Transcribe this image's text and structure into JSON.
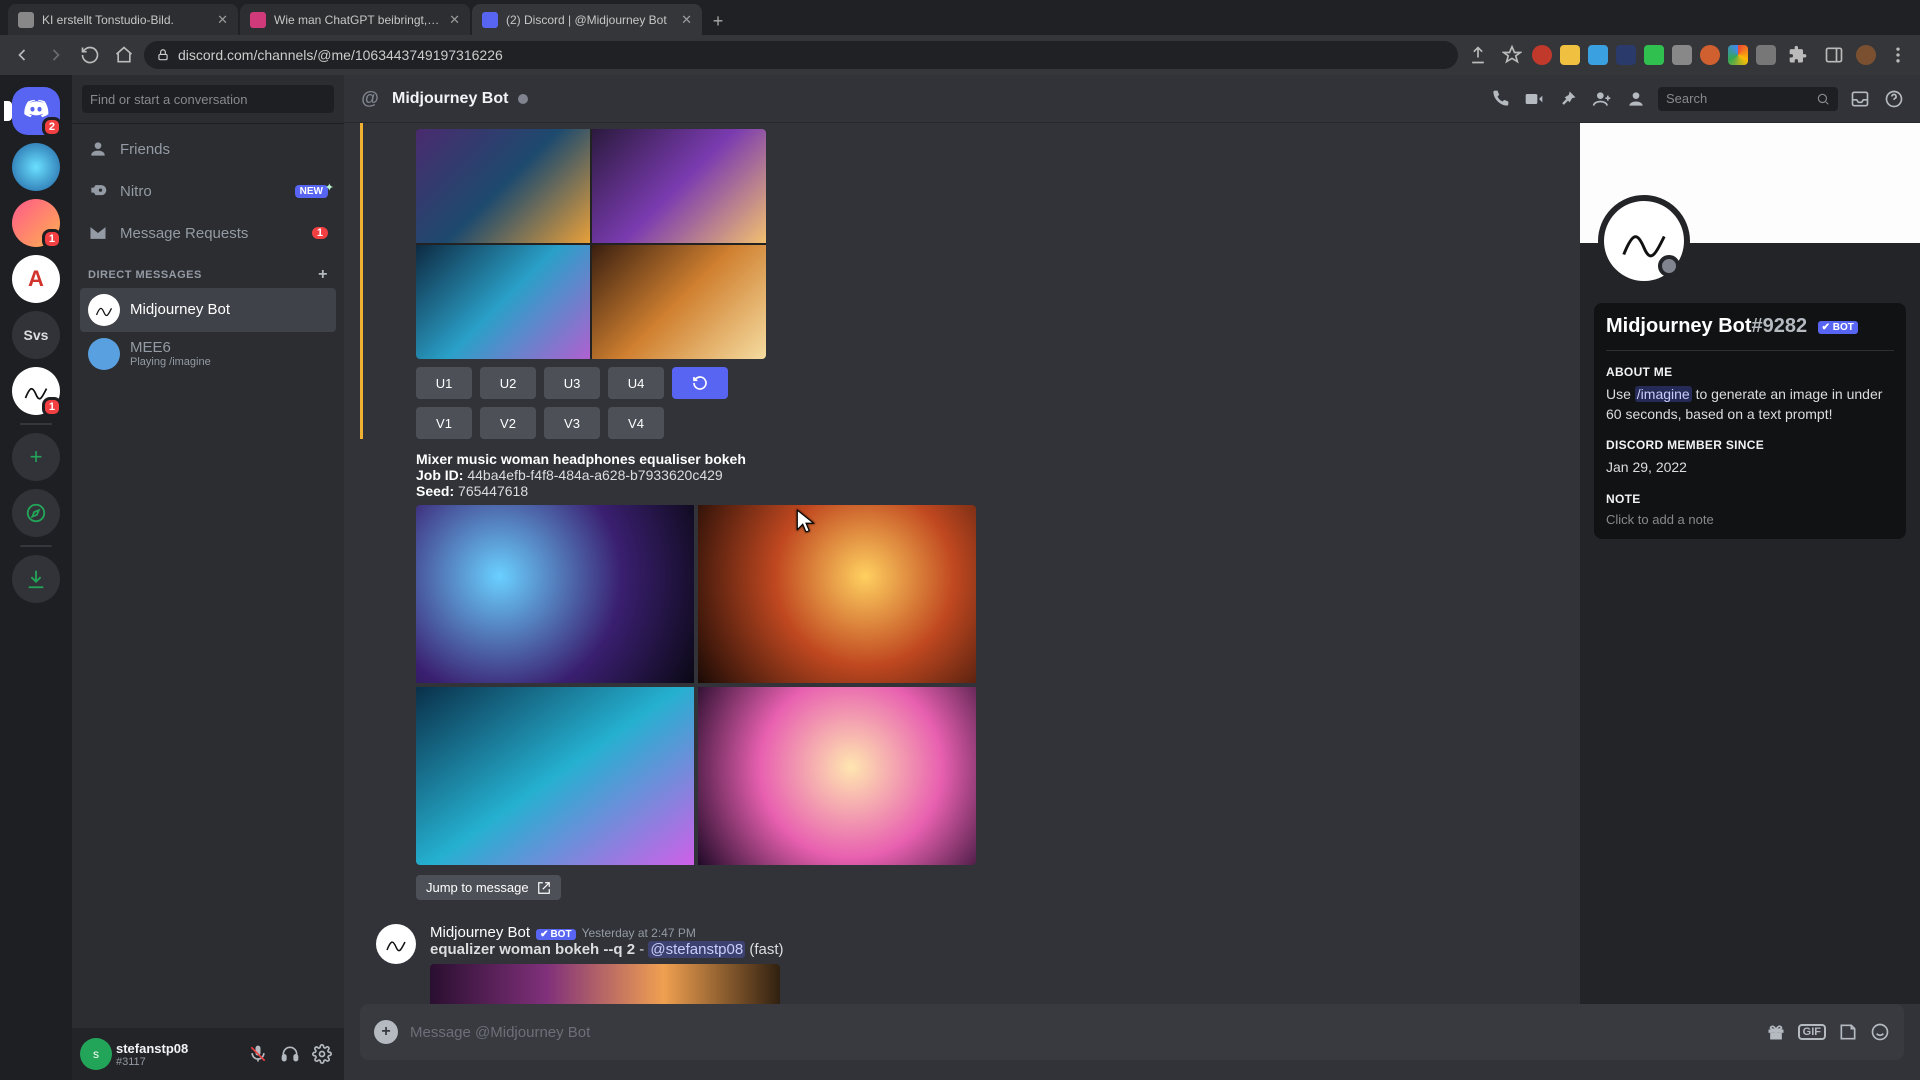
{
  "browser": {
    "tabs": [
      {
        "title": "KI erstellt Tonstudio-Bild.",
        "favicon": "#888888",
        "active": false
      },
      {
        "title": "Wie man ChatGPT beibringt, be",
        "favicon": "#d13a7a",
        "active": false
      },
      {
        "title": "(2) Discord | @Midjourney Bot",
        "favicon": "#5865f2",
        "active": true
      }
    ],
    "url": "discord.com/channels/@me/1063443749197316226"
  },
  "servers": {
    "items": [
      {
        "label": "DM",
        "badge": "2",
        "active": true,
        "color": "#5865f2"
      },
      {
        "label": "",
        "badge": null,
        "color": "#3aa0e0"
      },
      {
        "label": "",
        "badge": "1",
        "color": "linear"
      },
      {
        "label": "A",
        "badge": null,
        "color": "#ffffff"
      },
      {
        "label": "Svs",
        "badge": null,
        "color": "#313338"
      },
      {
        "label": "",
        "badge": "1",
        "color": "#ffffff"
      }
    ]
  },
  "dm": {
    "search_placeholder": "Find or start a conversation",
    "links": {
      "friends": "Friends",
      "nitro": "Nitro",
      "nitro_badge": "NEW",
      "message_requests": "Message Requests",
      "message_requests_count": "1"
    },
    "header": "DIRECT MESSAGES",
    "items": [
      {
        "name": "Midjourney Bot",
        "sub": null,
        "active": true
      },
      {
        "name": "MEE6",
        "sub": "Playing /imagine",
        "active": false
      }
    ]
  },
  "user_panel": {
    "name": "stefanstp08",
    "tag": "#3117"
  },
  "channel": {
    "name": "Midjourney Bot",
    "search_placeholder": "Search"
  },
  "scrollback": {
    "u_buttons": [
      "U1",
      "U2",
      "U3",
      "U4"
    ],
    "v_buttons": [
      "V1",
      "V2",
      "V3",
      "V4"
    ],
    "prompt_title": "Mixer music woman headphones equaliser bokeh",
    "job_id_label": "Job ID",
    "job_id": "44ba4efb-f4f8-484a-a628-b7933620c429",
    "seed_label": "Seed",
    "seed": "765447618",
    "jump_label": "Jump to message"
  },
  "message2": {
    "author": "Midjourney Bot",
    "bot_tag": "BOT",
    "timestamp": "Yesterday at 2:47 PM",
    "prompt_strong": "equalizer woman bokeh --q 2",
    "prompt_sep": " - ",
    "prompt_mention": "@stefanstp08",
    "prompt_tail": " (fast)"
  },
  "composer": {
    "placeholder": "Message @Midjourney Bot"
  },
  "profile": {
    "name": "Midjourney Bot",
    "tag": "#9282",
    "bot_tag": "✔ BOT",
    "about_title": "ABOUT ME",
    "about_pre": "Use ",
    "about_cmd": "/imagine",
    "about_post": " to generate an image in under 60 seconds, based on a text prompt!",
    "member_since_title": "DISCORD MEMBER SINCE",
    "member_since": "Jan 29, 2022",
    "note_title": "NOTE",
    "note_placeholder": "Click to add a note"
  }
}
